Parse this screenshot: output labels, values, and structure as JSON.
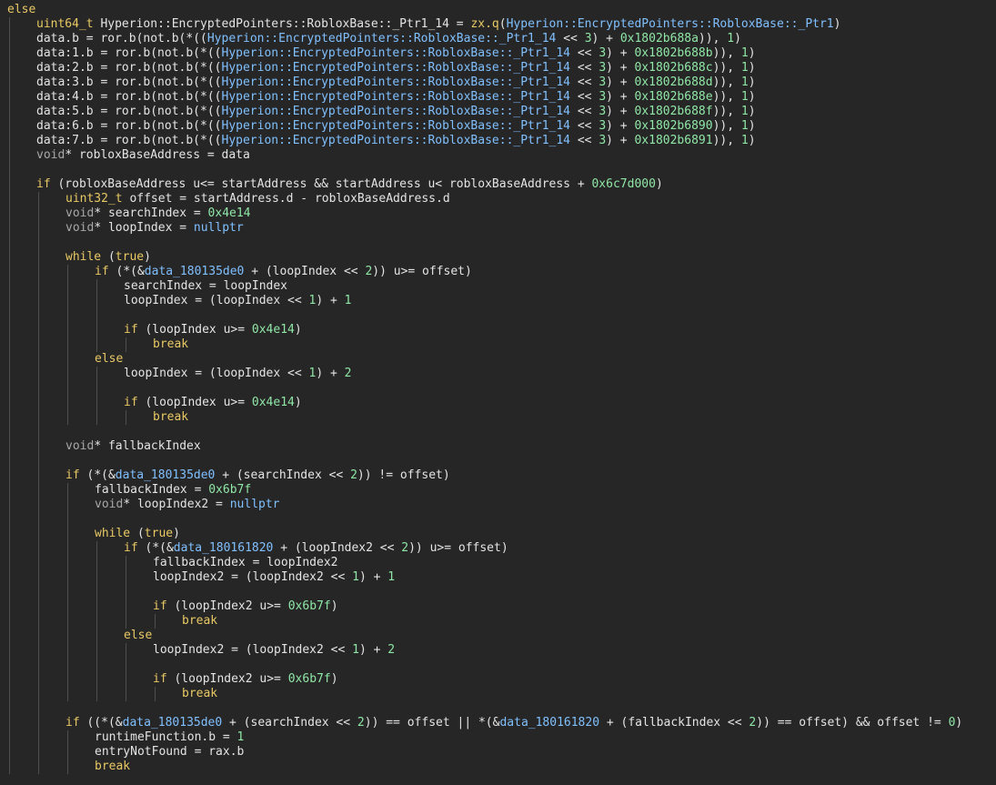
{
  "view": "decompiler-pseudo-c",
  "colors": {
    "background": "#262626",
    "text": "#e4e4e4",
    "keyword": "#e8c964",
    "number": "#8fe6a6",
    "namespace": "#80c0ff",
    "guide": "#505050"
  },
  "lines": [
    {
      "indent": 0,
      "tokens": [
        {
          "t": "kw",
          "v": "else"
        }
      ]
    },
    {
      "indent": 1,
      "tokens": [
        {
          "t": "tp",
          "v": "uint64_t"
        },
        {
          "t": "id",
          "v": " Hyperion::EncryptedPointers::RobloxBase::_Ptr1_14 = "
        },
        {
          "t": "kw",
          "v": "zx.q"
        },
        {
          "t": "paren",
          "v": "("
        },
        {
          "t": "ns",
          "v": "Hyperion::EncryptedPointers::RobloxBase::_Ptr1"
        },
        {
          "t": "paren",
          "v": ")"
        }
      ]
    },
    {
      "indent": 1,
      "tokens": [
        {
          "t": "id",
          "v": "data.b = ror.b(not.b("
        },
        {
          "t": "op",
          "v": "*(("
        },
        {
          "t": "ns",
          "v": "Hyperion::EncryptedPointers::RobloxBase::_Ptr1_14"
        },
        {
          "t": "op",
          "v": " << "
        },
        {
          "t": "num",
          "v": "3"
        },
        {
          "t": "op",
          "v": ") + "
        },
        {
          "t": "num",
          "v": "0x1802b688a"
        },
        {
          "t": "op",
          "v": ")), "
        },
        {
          "t": "num",
          "v": "1"
        },
        {
          "t": "op",
          "v": ")"
        }
      ]
    },
    {
      "indent": 1,
      "tokens": [
        {
          "t": "id",
          "v": "data:1.b = ror.b(not.b("
        },
        {
          "t": "op",
          "v": "*(("
        },
        {
          "t": "ns",
          "v": "Hyperion::EncryptedPointers::RobloxBase::_Ptr1_14"
        },
        {
          "t": "op",
          "v": " << "
        },
        {
          "t": "num",
          "v": "3"
        },
        {
          "t": "op",
          "v": ") + "
        },
        {
          "t": "num",
          "v": "0x1802b688b"
        },
        {
          "t": "op",
          "v": ")), "
        },
        {
          "t": "num",
          "v": "1"
        },
        {
          "t": "op",
          "v": ")"
        }
      ]
    },
    {
      "indent": 1,
      "tokens": [
        {
          "t": "id",
          "v": "data:2.b = ror.b(not.b("
        },
        {
          "t": "op",
          "v": "*(("
        },
        {
          "t": "ns",
          "v": "Hyperion::EncryptedPointers::RobloxBase::_Ptr1_14"
        },
        {
          "t": "op",
          "v": " << "
        },
        {
          "t": "num",
          "v": "3"
        },
        {
          "t": "op",
          "v": ") + "
        },
        {
          "t": "num",
          "v": "0x1802b688c"
        },
        {
          "t": "op",
          "v": ")), "
        },
        {
          "t": "num",
          "v": "1"
        },
        {
          "t": "op",
          "v": ")"
        }
      ]
    },
    {
      "indent": 1,
      "tokens": [
        {
          "t": "id",
          "v": "data:3.b = ror.b(not.b("
        },
        {
          "t": "op",
          "v": "*(("
        },
        {
          "t": "ns",
          "v": "Hyperion::EncryptedPointers::RobloxBase::_Ptr1_14"
        },
        {
          "t": "op",
          "v": " << "
        },
        {
          "t": "num",
          "v": "3"
        },
        {
          "t": "op",
          "v": ") + "
        },
        {
          "t": "num",
          "v": "0x1802b688d"
        },
        {
          "t": "op",
          "v": ")), "
        },
        {
          "t": "num",
          "v": "1"
        },
        {
          "t": "op",
          "v": ")"
        }
      ]
    },
    {
      "indent": 1,
      "tokens": [
        {
          "t": "id",
          "v": "data:4.b = ror.b(not.b("
        },
        {
          "t": "op",
          "v": "*(("
        },
        {
          "t": "ns",
          "v": "Hyperion::EncryptedPointers::RobloxBase::_Ptr1_14"
        },
        {
          "t": "op",
          "v": " << "
        },
        {
          "t": "num",
          "v": "3"
        },
        {
          "t": "op",
          "v": ") + "
        },
        {
          "t": "num",
          "v": "0x1802b688e"
        },
        {
          "t": "op",
          "v": ")), "
        },
        {
          "t": "num",
          "v": "1"
        },
        {
          "t": "op",
          "v": ")"
        }
      ]
    },
    {
      "indent": 1,
      "tokens": [
        {
          "t": "id",
          "v": "data:5.b = ror.b(not.b("
        },
        {
          "t": "op",
          "v": "*(("
        },
        {
          "t": "ns",
          "v": "Hyperion::EncryptedPointers::RobloxBase::_Ptr1_14"
        },
        {
          "t": "op",
          "v": " << "
        },
        {
          "t": "num",
          "v": "3"
        },
        {
          "t": "op",
          "v": ") + "
        },
        {
          "t": "num",
          "v": "0x1802b688f"
        },
        {
          "t": "op",
          "v": ")), "
        },
        {
          "t": "num",
          "v": "1"
        },
        {
          "t": "op",
          "v": ")"
        }
      ]
    },
    {
      "indent": 1,
      "tokens": [
        {
          "t": "id",
          "v": "data:6.b = ror.b(not.b("
        },
        {
          "t": "op",
          "v": "*(("
        },
        {
          "t": "ns",
          "v": "Hyperion::EncryptedPointers::RobloxBase::_Ptr1_14"
        },
        {
          "t": "op",
          "v": " << "
        },
        {
          "t": "num",
          "v": "3"
        },
        {
          "t": "op",
          "v": ") + "
        },
        {
          "t": "num",
          "v": "0x1802b6890"
        },
        {
          "t": "op",
          "v": ")), "
        },
        {
          "t": "num",
          "v": "1"
        },
        {
          "t": "op",
          "v": ")"
        }
      ]
    },
    {
      "indent": 1,
      "tokens": [
        {
          "t": "id",
          "v": "data:7.b = ror.b(not.b("
        },
        {
          "t": "op",
          "v": "*(("
        },
        {
          "t": "ns",
          "v": "Hyperion::EncryptedPointers::RobloxBase::_Ptr1_14"
        },
        {
          "t": "op",
          "v": " << "
        },
        {
          "t": "num",
          "v": "3"
        },
        {
          "t": "op",
          "v": ") + "
        },
        {
          "t": "num",
          "v": "0x1802b6891"
        },
        {
          "t": "op",
          "v": ")), "
        },
        {
          "t": "num",
          "v": "1"
        },
        {
          "t": "op",
          "v": ")"
        }
      ]
    },
    {
      "indent": 1,
      "tokens": [
        {
          "t": "void",
          "v": "void"
        },
        {
          "t": "id",
          "v": "* robloxBaseAddress = data"
        }
      ]
    },
    {
      "indent": 1,
      "tokens": []
    },
    {
      "indent": 1,
      "tokens": [
        {
          "t": "kw",
          "v": "if"
        },
        {
          "t": "id",
          "v": " (robloxBaseAddress u<= startAddress && startAddress u< robloxBaseAddress + "
        },
        {
          "t": "num",
          "v": "0x6c7d000"
        },
        {
          "t": "id",
          "v": ")"
        }
      ]
    },
    {
      "indent": 2,
      "tokens": [
        {
          "t": "tp",
          "v": "uint32_t"
        },
        {
          "t": "id",
          "v": " offset = startAddress.d - robloxBaseAddress.d"
        }
      ]
    },
    {
      "indent": 2,
      "tokens": [
        {
          "t": "void",
          "v": "void"
        },
        {
          "t": "id",
          "v": "* searchIndex = "
        },
        {
          "t": "num",
          "v": "0x4e14"
        }
      ]
    },
    {
      "indent": 2,
      "tokens": [
        {
          "t": "void",
          "v": "void"
        },
        {
          "t": "id",
          "v": "* loopIndex = "
        },
        {
          "t": "ns",
          "v": "nullptr"
        }
      ]
    },
    {
      "indent": 2,
      "tokens": []
    },
    {
      "indent": 2,
      "tokens": [
        {
          "t": "kw",
          "v": "while"
        },
        {
          "t": "id",
          "v": " ("
        },
        {
          "t": "kw",
          "v": "true"
        },
        {
          "t": "id",
          "v": ")"
        }
      ]
    },
    {
      "indent": 3,
      "tokens": [
        {
          "t": "kw",
          "v": "if"
        },
        {
          "t": "id",
          "v": " ("
        },
        {
          "t": "op",
          "v": "*(&"
        },
        {
          "t": "ns",
          "v": "data_180135de0"
        },
        {
          "t": "id",
          "v": " + (loopIndex << "
        },
        {
          "t": "num",
          "v": "2"
        },
        {
          "t": "id",
          "v": ")) u>= offset)"
        }
      ]
    },
    {
      "indent": 4,
      "tokens": [
        {
          "t": "id",
          "v": "searchIndex = loopIndex"
        }
      ]
    },
    {
      "indent": 4,
      "tokens": [
        {
          "t": "id",
          "v": "loopIndex = (loopIndex << "
        },
        {
          "t": "num",
          "v": "1"
        },
        {
          "t": "id",
          "v": ") + "
        },
        {
          "t": "num",
          "v": "1"
        }
      ]
    },
    {
      "indent": 4,
      "tokens": []
    },
    {
      "indent": 4,
      "tokens": [
        {
          "t": "kw",
          "v": "if"
        },
        {
          "t": "id",
          "v": " (loopIndex u>= "
        },
        {
          "t": "num",
          "v": "0x4e14"
        },
        {
          "t": "id",
          "v": ")"
        }
      ]
    },
    {
      "indent": 5,
      "tokens": [
        {
          "t": "kw",
          "v": "break"
        }
      ]
    },
    {
      "indent": 3,
      "tokens": [
        {
          "t": "kw",
          "v": "else"
        }
      ]
    },
    {
      "indent": 4,
      "tokens": [
        {
          "t": "id",
          "v": "loopIndex = (loopIndex << "
        },
        {
          "t": "num",
          "v": "1"
        },
        {
          "t": "id",
          "v": ") + "
        },
        {
          "t": "num",
          "v": "2"
        }
      ]
    },
    {
      "indent": 4,
      "tokens": []
    },
    {
      "indent": 4,
      "tokens": [
        {
          "t": "kw",
          "v": "if"
        },
        {
          "t": "id",
          "v": " (loopIndex u>= "
        },
        {
          "t": "num",
          "v": "0x4e14"
        },
        {
          "t": "id",
          "v": ")"
        }
      ]
    },
    {
      "indent": 5,
      "tokens": [
        {
          "t": "kw",
          "v": "break"
        }
      ]
    },
    {
      "indent": 2,
      "tokens": []
    },
    {
      "indent": 2,
      "tokens": [
        {
          "t": "void",
          "v": "void"
        },
        {
          "t": "id",
          "v": "* fallbackIndex"
        }
      ]
    },
    {
      "indent": 2,
      "tokens": []
    },
    {
      "indent": 2,
      "tokens": [
        {
          "t": "kw",
          "v": "if"
        },
        {
          "t": "id",
          "v": " ("
        },
        {
          "t": "op",
          "v": "*(&"
        },
        {
          "t": "ns",
          "v": "data_180135de0"
        },
        {
          "t": "id",
          "v": " + (searchIndex << "
        },
        {
          "t": "num",
          "v": "2"
        },
        {
          "t": "id",
          "v": ")) != offset)"
        }
      ]
    },
    {
      "indent": 3,
      "tokens": [
        {
          "t": "id",
          "v": "fallbackIndex = "
        },
        {
          "t": "num",
          "v": "0x6b7f"
        }
      ]
    },
    {
      "indent": 3,
      "tokens": [
        {
          "t": "void",
          "v": "void"
        },
        {
          "t": "id",
          "v": "* loopIndex2 = "
        },
        {
          "t": "ns",
          "v": "nullptr"
        }
      ]
    },
    {
      "indent": 3,
      "tokens": []
    },
    {
      "indent": 3,
      "tokens": [
        {
          "t": "kw",
          "v": "while"
        },
        {
          "t": "id",
          "v": " ("
        },
        {
          "t": "kw",
          "v": "true"
        },
        {
          "t": "id",
          "v": ")"
        }
      ]
    },
    {
      "indent": 4,
      "tokens": [
        {
          "t": "kw",
          "v": "if"
        },
        {
          "t": "id",
          "v": " ("
        },
        {
          "t": "op",
          "v": "*(&"
        },
        {
          "t": "ns",
          "v": "data_180161820"
        },
        {
          "t": "id",
          "v": " + (loopIndex2 << "
        },
        {
          "t": "num",
          "v": "2"
        },
        {
          "t": "id",
          "v": ")) u>= offset)"
        }
      ]
    },
    {
      "indent": 5,
      "tokens": [
        {
          "t": "id",
          "v": "fallbackIndex = loopIndex2"
        }
      ]
    },
    {
      "indent": 5,
      "tokens": [
        {
          "t": "id",
          "v": "loopIndex2 = (loopIndex2 << "
        },
        {
          "t": "num",
          "v": "1"
        },
        {
          "t": "id",
          "v": ") + "
        },
        {
          "t": "num",
          "v": "1"
        }
      ]
    },
    {
      "indent": 5,
      "tokens": []
    },
    {
      "indent": 5,
      "tokens": [
        {
          "t": "kw",
          "v": "if"
        },
        {
          "t": "id",
          "v": " (loopIndex2 u>= "
        },
        {
          "t": "num",
          "v": "0x6b7f"
        },
        {
          "t": "id",
          "v": ")"
        }
      ]
    },
    {
      "indent": 6,
      "tokens": [
        {
          "t": "kw",
          "v": "break"
        }
      ]
    },
    {
      "indent": 4,
      "tokens": [
        {
          "t": "kw",
          "v": "else"
        }
      ]
    },
    {
      "indent": 5,
      "tokens": [
        {
          "t": "id",
          "v": "loopIndex2 = (loopIndex2 << "
        },
        {
          "t": "num",
          "v": "1"
        },
        {
          "t": "id",
          "v": ") + "
        },
        {
          "t": "num",
          "v": "2"
        }
      ]
    },
    {
      "indent": 5,
      "tokens": []
    },
    {
      "indent": 5,
      "tokens": [
        {
          "t": "kw",
          "v": "if"
        },
        {
          "t": "id",
          "v": " (loopIndex2 u>= "
        },
        {
          "t": "num",
          "v": "0x6b7f"
        },
        {
          "t": "id",
          "v": ")"
        }
      ]
    },
    {
      "indent": 6,
      "tokens": [
        {
          "t": "kw",
          "v": "break"
        }
      ]
    },
    {
      "indent": 2,
      "tokens": []
    },
    {
      "indent": 2,
      "tokens": [
        {
          "t": "kw",
          "v": "if"
        },
        {
          "t": "id",
          "v": " (("
        },
        {
          "t": "op",
          "v": "*(&"
        },
        {
          "t": "ns",
          "v": "data_180135de0"
        },
        {
          "t": "id",
          "v": " + (searchIndex << "
        },
        {
          "t": "num",
          "v": "2"
        },
        {
          "t": "id",
          "v": ")) == offset || "
        },
        {
          "t": "op",
          "v": "*(&"
        },
        {
          "t": "ns",
          "v": "data_180161820"
        },
        {
          "t": "id",
          "v": " + (fallbackIndex << "
        },
        {
          "t": "num",
          "v": "2"
        },
        {
          "t": "id",
          "v": ")) == offset) && offset != "
        },
        {
          "t": "num",
          "v": "0"
        },
        {
          "t": "id",
          "v": ")"
        }
      ]
    },
    {
      "indent": 3,
      "tokens": [
        {
          "t": "id",
          "v": "runtimeFunction.b = "
        },
        {
          "t": "num",
          "v": "1"
        }
      ]
    },
    {
      "indent": 3,
      "tokens": [
        {
          "t": "id",
          "v": "entryNotFound = rax.b"
        }
      ]
    },
    {
      "indent": 3,
      "tokens": [
        {
          "t": "kw",
          "v": "break"
        }
      ]
    }
  ]
}
